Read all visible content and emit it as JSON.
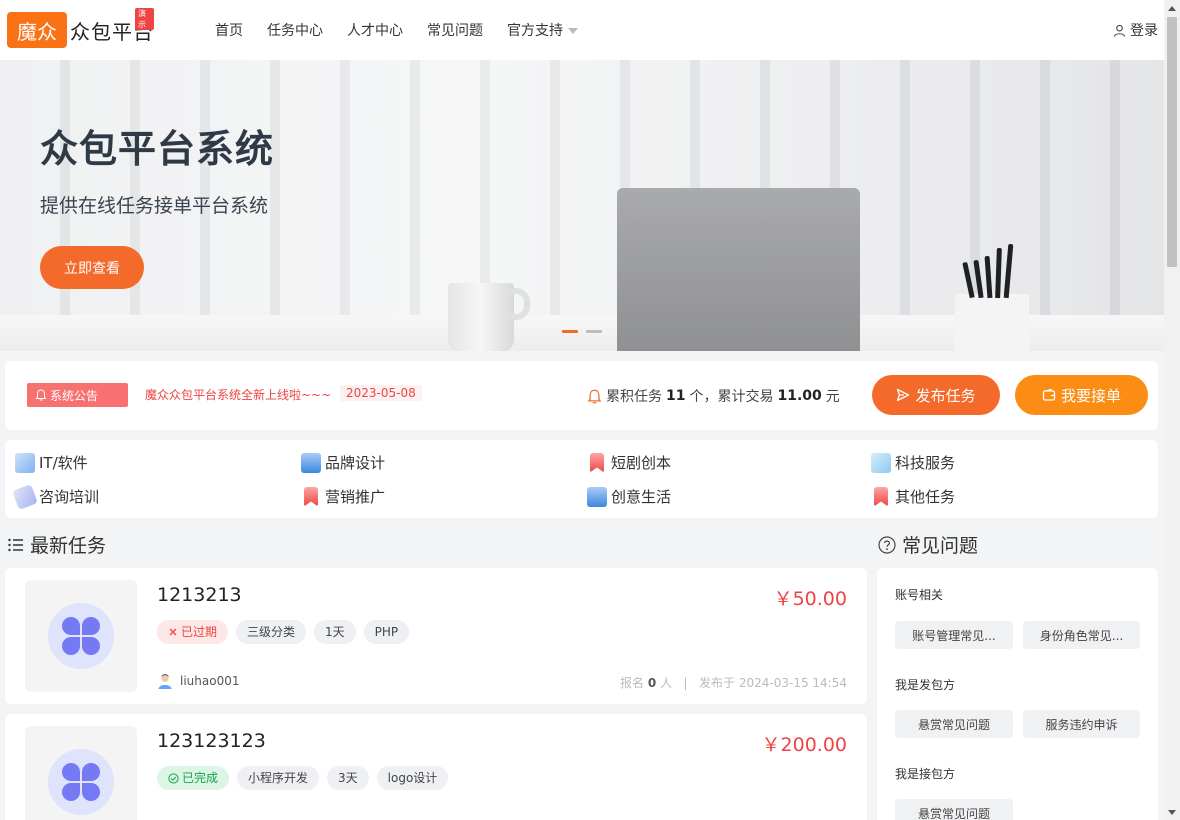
{
  "header": {
    "logo_box": "魔众",
    "logo_text": "众包平台",
    "logo_badge": "演示",
    "nav": [
      "首页",
      "任务中心",
      "人才中心",
      "常见问题",
      "官方支持"
    ],
    "login": "登录"
  },
  "banner": {
    "title": "众包平台系统",
    "subtitle": "提供在线任务接单平台系统",
    "button": "立即查看"
  },
  "notice": {
    "tag": "系统公告",
    "text": "魔众众包平台系统全新上线啦~~~",
    "date": "2023-05-08",
    "stats_prefix": "累积任务",
    "task_count": "11",
    "stats_mid": "个，累计交易",
    "trade_amount": "11.00",
    "stats_suffix": "元",
    "publish_button": "发布任务",
    "take_button": "我要接单"
  },
  "categories": [
    "IT/软件",
    "品牌设计",
    "短剧创本",
    "科技服务",
    "咨询培训",
    "营销推广",
    "创意生活",
    "其他任务"
  ],
  "tasks_section": {
    "title": "最新任务"
  },
  "tasks": [
    {
      "title": "1213213",
      "price": "￥50.00",
      "status": "已过期",
      "tags": [
        "三级分类",
        "1天",
        "PHP"
      ],
      "user": "liuhao001",
      "signup_prefix": "报名",
      "signup_count": "0",
      "signup_suffix": "人",
      "published": "发布于 2024-03-15 14:54"
    },
    {
      "title": "123123123",
      "price": "￥200.00",
      "status": "已完成",
      "tags": [
        "小程序开发",
        "3天",
        "logo设计"
      ]
    }
  ],
  "faq_section": {
    "title": "常见问题"
  },
  "faq": [
    {
      "group": "账号相关",
      "items": [
        "账号管理常见...",
        "身份角色常见..."
      ]
    },
    {
      "group": "我是发包方",
      "items": [
        "悬赏常见问题",
        "服务违约申诉"
      ]
    },
    {
      "group": "我是接包方",
      "items": [
        "悬赏常见问题"
      ]
    }
  ],
  "colors": {
    "accent": "#f46a2a",
    "accent2": "#fb8c14",
    "price": "#ef4444",
    "done": "#16a34a"
  }
}
